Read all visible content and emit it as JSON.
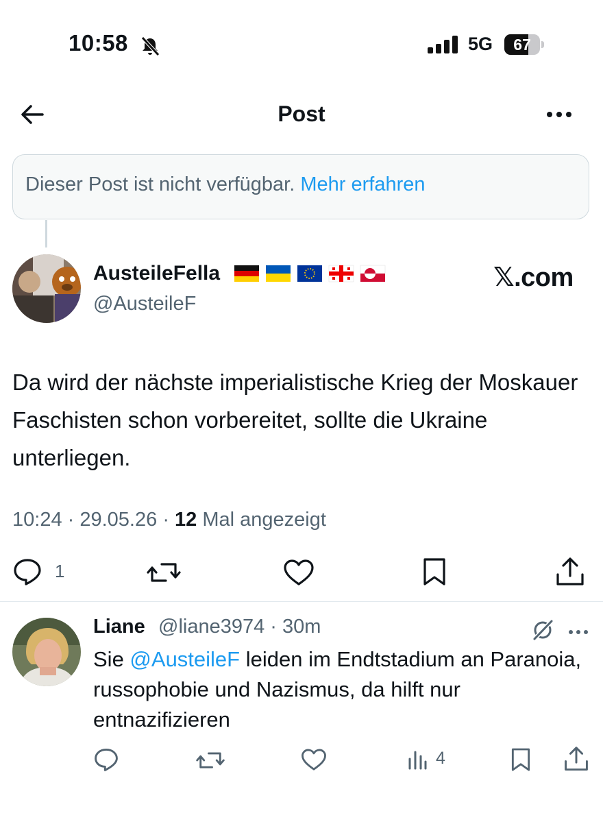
{
  "status_bar": {
    "time": "10:58",
    "network": "5G",
    "battery": "67",
    "battery_level": 0.67
  },
  "header": {
    "title": "Post"
  },
  "notice": {
    "text": "Dieser Post ist nicht verfügbar.",
    "link": "Mehr erfahren"
  },
  "post": {
    "author_name": "AusteileFella",
    "flags": [
      "germany-flag",
      "ukraine-flag",
      "eu-flag",
      "georgia-flag",
      "greenland-flag"
    ],
    "handle": "@AusteileF",
    "brand": "𝕏.com",
    "text": "Da wird der nächste imperialistische Krieg der Moskauer Faschisten schon vorbereitet, sollte die Ukraine unterliegen.",
    "time": "10:24",
    "date": "29.05.26",
    "views": "12",
    "views_label": "Mal angezeigt",
    "reply_count": "1"
  },
  "reply": {
    "name": "Liane",
    "handle": "@liane3974",
    "age": "30m",
    "text_prefix": "Sie ",
    "mention": "@AusteileF",
    "text_suffix": " leiden im Endtstadium an Paranoia, russophobie und Nazismus, da hilft nur entnazifizieren",
    "views": "4"
  },
  "colors": {
    "accent": "#1d9bf0",
    "muted": "#536471",
    "text": "#0f1419",
    "border": "#cfd9de"
  }
}
